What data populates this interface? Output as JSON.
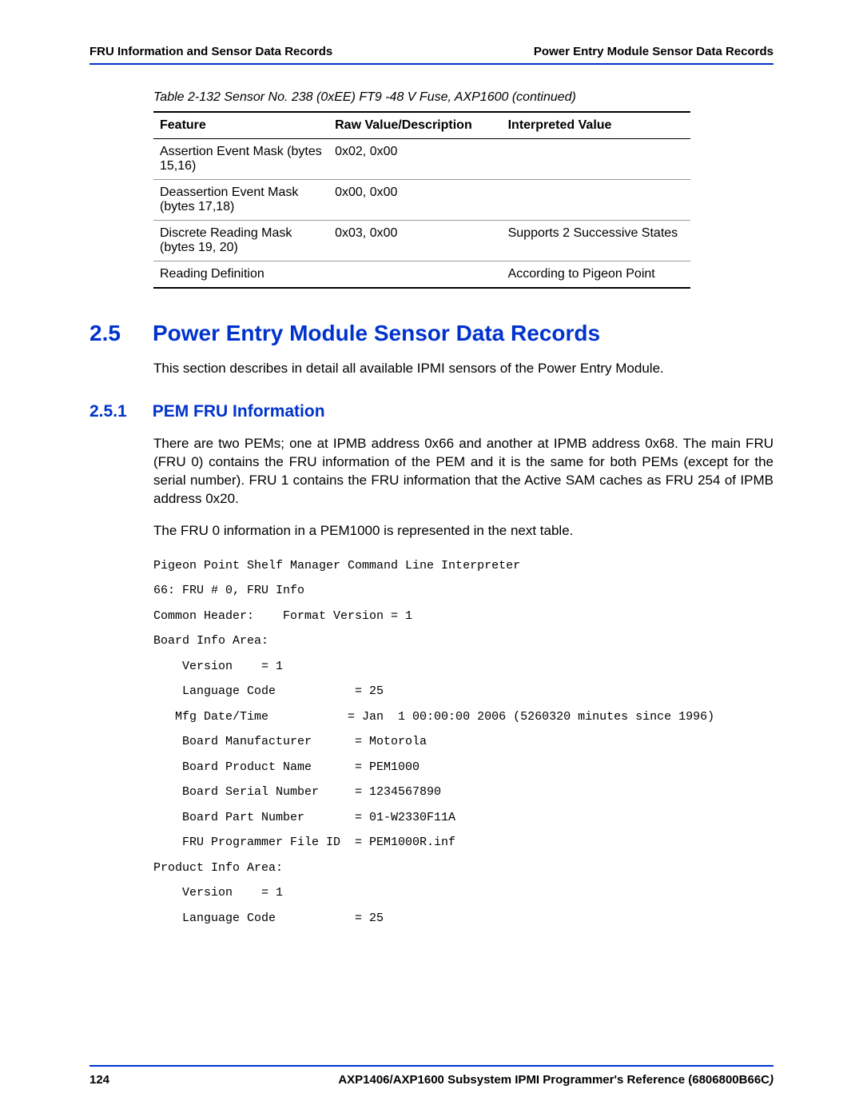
{
  "header": {
    "left": "FRU Information and Sensor Data Records",
    "right": "Power Entry Module Sensor Data Records"
  },
  "table": {
    "caption": "Table 2-132 Sensor No. 238 (0xEE) FT9 -48 V Fuse, AXP1600 (continued)",
    "headers": {
      "feature": "Feature",
      "raw": "Raw Value/Description",
      "interp": "Interpreted Value"
    },
    "rows": [
      {
        "feature": "Assertion Event Mask (bytes 15,16)",
        "raw": "0x02, 0x00",
        "interp": ""
      },
      {
        "feature": "Deassertion Event Mask (bytes 17,18)",
        "raw": "0x00, 0x00",
        "interp": ""
      },
      {
        "feature": "Discrete Reading Mask (bytes 19, 20)",
        "raw": "0x03, 0x00",
        "interp": "Supports 2 Successive States"
      },
      {
        "feature": "Reading Definition",
        "raw": "",
        "interp": "According to Pigeon Point"
      }
    ]
  },
  "section": {
    "number": "2.5",
    "title": "Power Entry Module Sensor Data Records",
    "intro": "This section describes in detail all available IPMI sensors of the Power Entry Module."
  },
  "subsection": {
    "number": "2.5.1",
    "title": "PEM FRU Information",
    "para1": "There are two PEMs; one at IPMB address 0x66 and another at IPMB address 0x68. The main FRU (FRU 0) contains the FRU information of the PEM and it is the same for both PEMs (except for the serial number). FRU 1 contains the FRU information that the Active SAM caches as FRU 254 of IPMB address 0x20.",
    "para2": "The FRU 0 information in a PEM1000 is represented in the next table."
  },
  "code": "Pigeon Point Shelf Manager Command Line Interpreter\n66: FRU # 0, FRU Info\nCommon Header:    Format Version = 1\nBoard Info Area:\n    Version    = 1\n    Language Code           = 25\n   Mfg Date/Time           = Jan  1 00:00:00 2006 (5260320 minutes since 1996)\n    Board Manufacturer      = Motorola\n    Board Product Name      = PEM1000\n    Board Serial Number     = 1234567890\n    Board Part Number       = 01-W2330F11A\n    FRU Programmer File ID  = PEM1000R.inf\nProduct Info Area:\n    Version    = 1\n    Language Code           = 25",
  "footer": {
    "page": "124",
    "docref": "AXP1406/AXP1600 Subsystem IPMI Programmer's Reference (6806800B66C",
    "docref_suffix": ")"
  }
}
